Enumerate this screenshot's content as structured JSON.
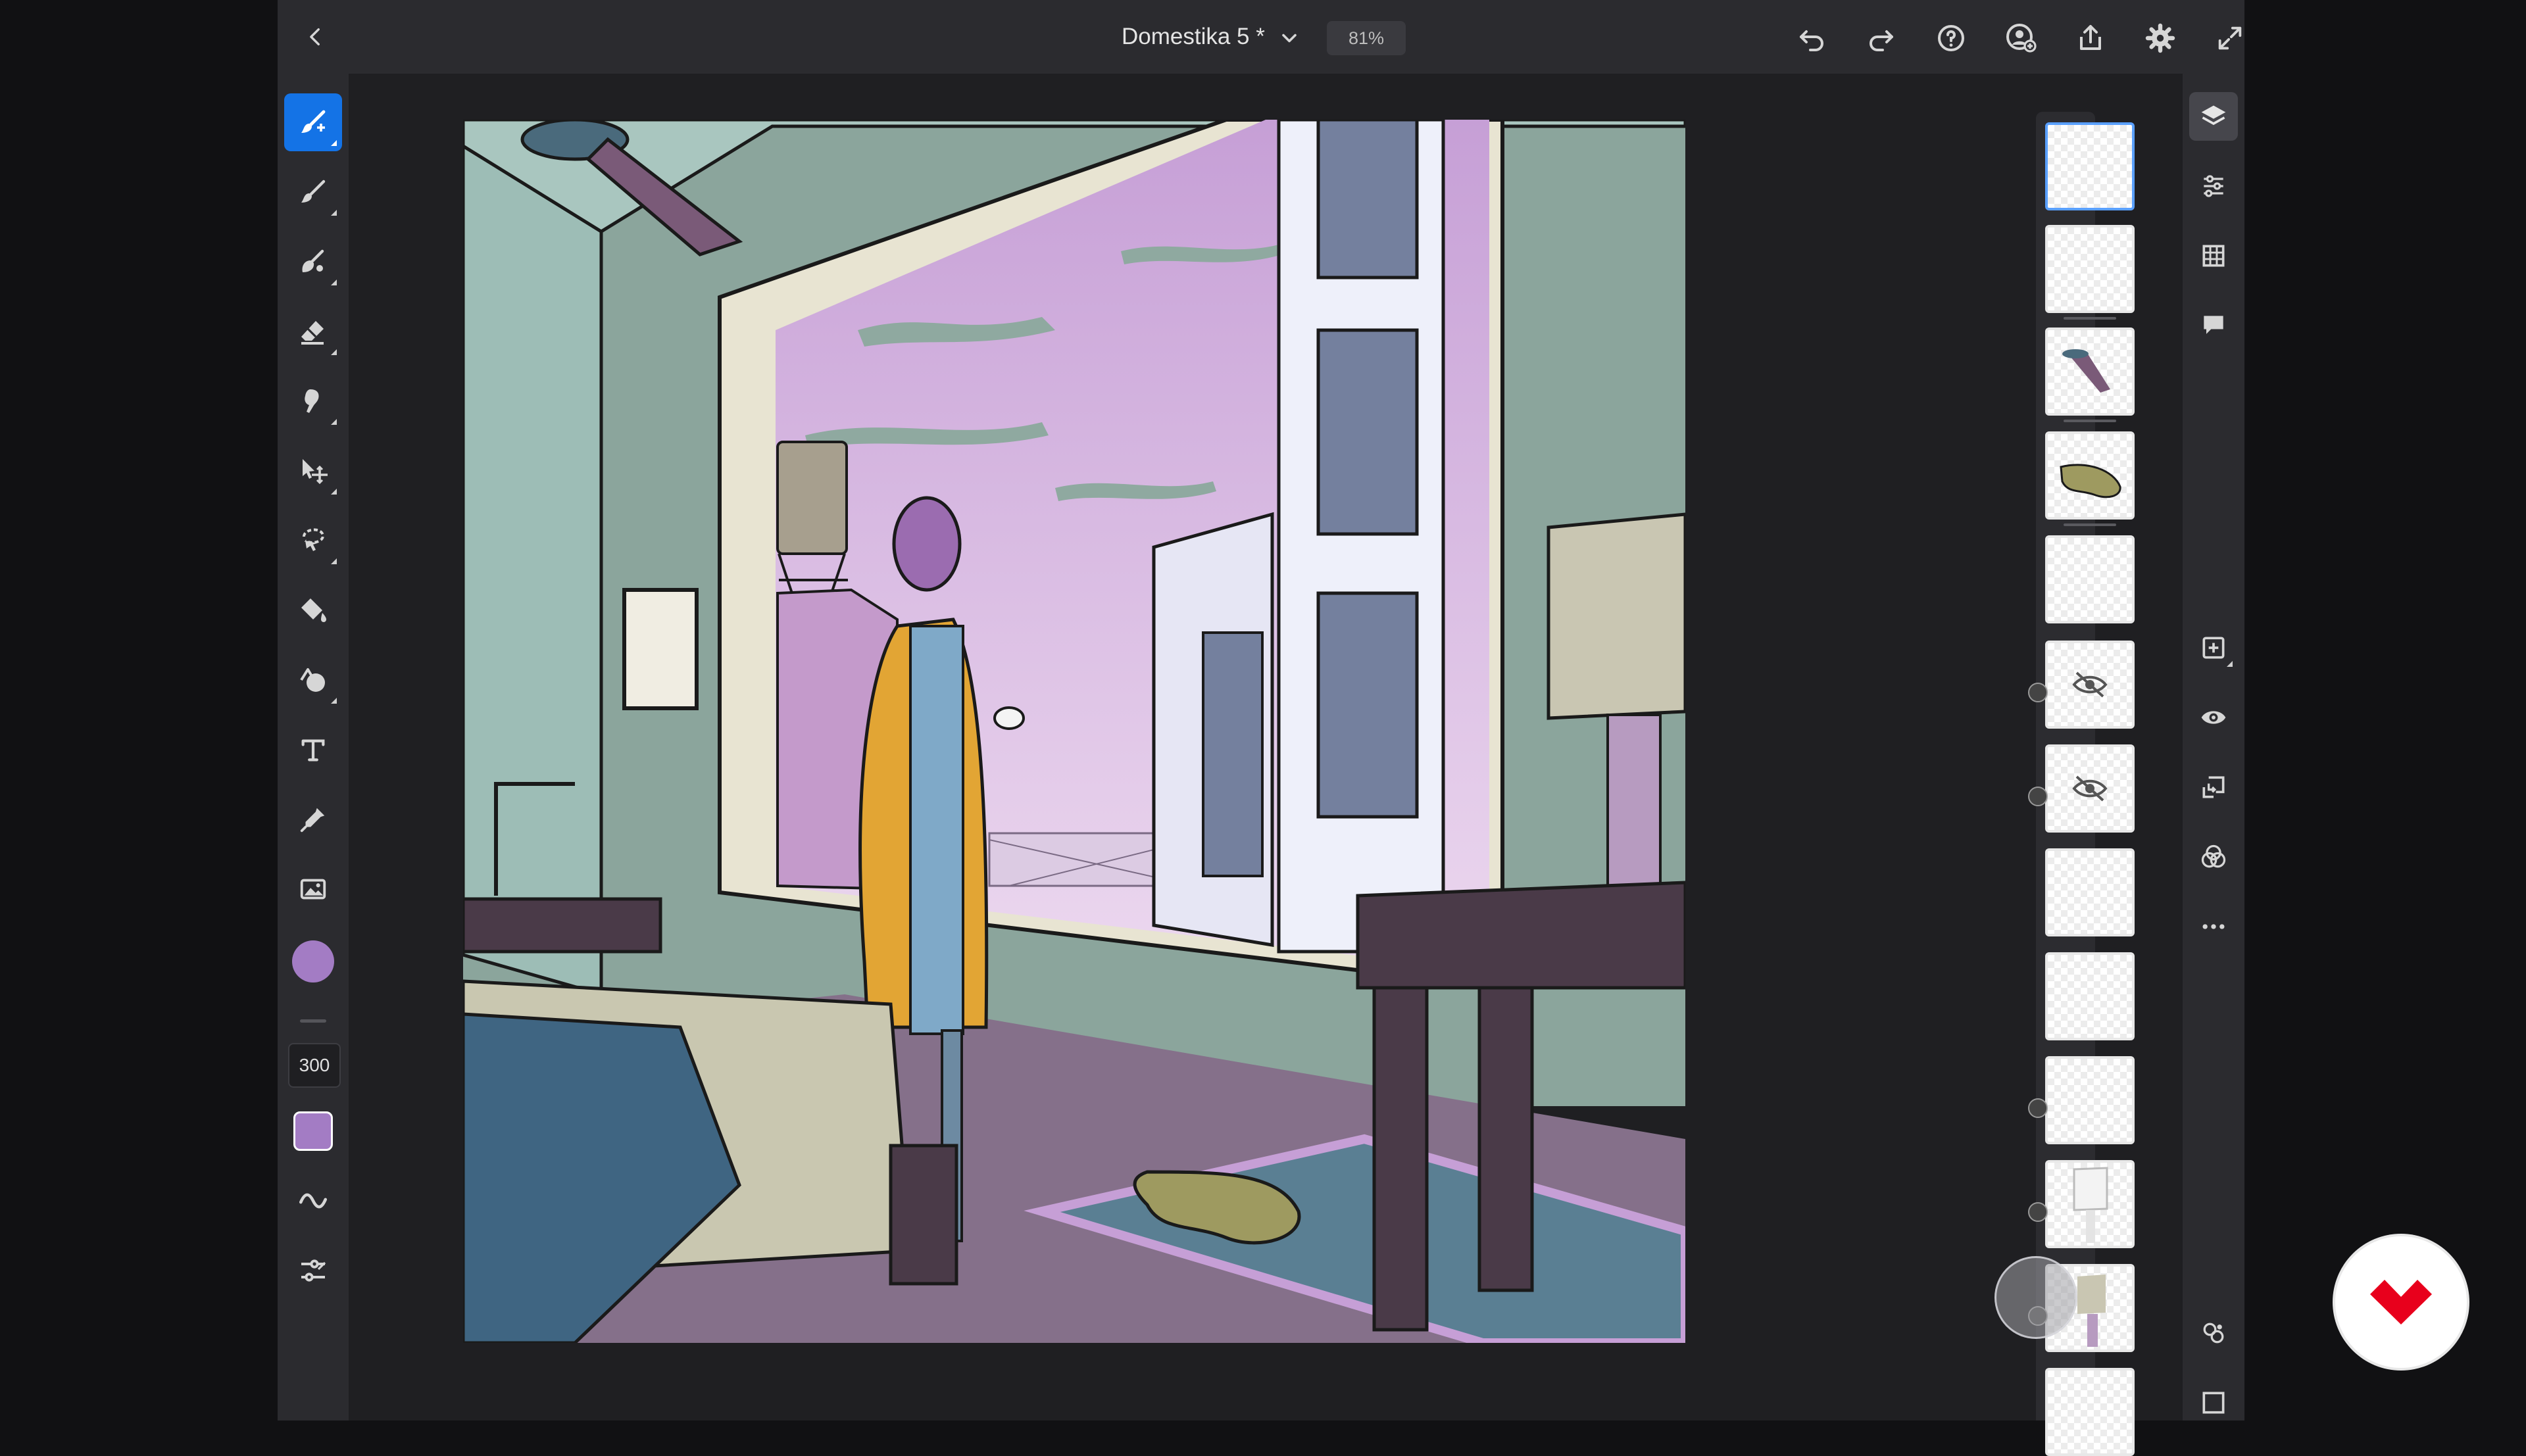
{
  "header": {
    "document_title": "Domestika 5 *",
    "zoom": "81%"
  },
  "toolbar": {
    "brush_size": "300",
    "primary_color": "#a37cc4",
    "secondary_color": "#a37cc4",
    "active_tool": "brush-tool-icon"
  },
  "colors": {
    "accent": "#1473e6",
    "panel": "#2b2b2f",
    "brand": "#e8001c"
  }
}
